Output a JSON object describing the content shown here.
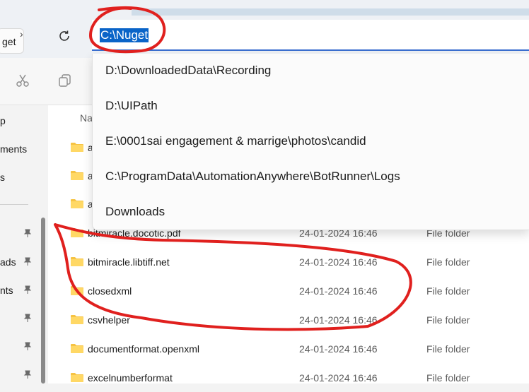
{
  "tooltip": {
    "text": "get"
  },
  "address_bar": {
    "value": "C:\\Nuget"
  },
  "suggestions": [
    "D:\\DownloadedData\\Recording",
    "D:\\UIPath",
    "E:\\0001sai engagement & marrige\\photos\\candid",
    "C:\\ProgramData\\AutomationAnywhere\\BotRunner\\Logs",
    "Downloads"
  ],
  "sidebar": {
    "items": [
      "p",
      "ments",
      "s",
      "ads",
      "nts"
    ]
  },
  "columns": {
    "name": "Na"
  },
  "files": [
    {
      "name": "a",
      "date": "",
      "type": ""
    },
    {
      "name": "a",
      "date": "",
      "type": ""
    },
    {
      "name": "a",
      "date": "",
      "type": ""
    },
    {
      "name": "bitmiracle.docotic.pdf",
      "date": "24-01-2024 16:46",
      "type": "File folder"
    },
    {
      "name": "bitmiracle.libtiff.net",
      "date": "24-01-2024 16:46",
      "type": "File folder"
    },
    {
      "name": "closedxml",
      "date": "24-01-2024 16:46",
      "type": "File folder"
    },
    {
      "name": "csvhelper",
      "date": "24-01-2024 16:46",
      "type": "File folder"
    },
    {
      "name": "documentformat.openxml",
      "date": "24-01-2024 16:46",
      "type": "File folder"
    },
    {
      "name": "excelnumberformat",
      "date": "24-01-2024 16:46",
      "type": "File folder"
    }
  ],
  "colors": {
    "selection": "#0a64c8",
    "annotation": "#e0201e",
    "folder": "#f6c343"
  }
}
